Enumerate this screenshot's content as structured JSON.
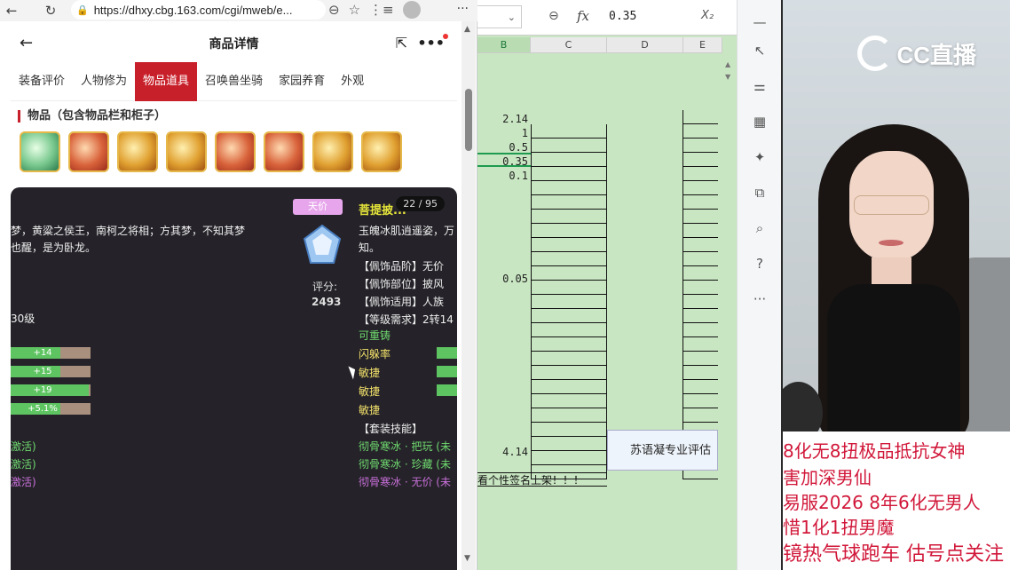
{
  "browser": {
    "url": "https://dhxy.cbg.163.com/cgi/mweb/e...",
    "page_title": "商品详情",
    "tabs": [
      "装备评价",
      "人物修为",
      "物品道具",
      "召唤兽坐骑",
      "家园养育",
      "外观"
    ],
    "active_tab": "物品道具",
    "section_title": "物品（包含物品栏和柜子）",
    "detail": {
      "counter": "22 / 95",
      "badge": "天价",
      "item_name": "菩提披...",
      "story_left": [
        "梦，黄粱之侯王，南柯之将相；方其梦，不知其梦",
        "也醒，是为卧龙。"
      ],
      "story_right": [
        "玉魄冰肌逍遥姿，万",
        "知。"
      ],
      "score_label": "评分:",
      "score_value": "2493",
      "attrs": [
        "【佩饰品阶】无价",
        "【佩饰部位】披风",
        "【佩饰适用】人族",
        "【等级需求】2转14"
      ],
      "level_left": "30级",
      "rework": "可重铸",
      "bars": [
        {
          "label": "+14",
          "fill": 0.62
        },
        {
          "label": "+15",
          "fill": 0.62
        },
        {
          "label": "+19",
          "fill": 0.98
        },
        {
          "label": "+5.1%",
          "fill": 0.62
        }
      ],
      "stats_right": [
        "闪躲率",
        "敏捷",
        "敏捷",
        "敏捷"
      ],
      "set_skill_title": "【套装技能】",
      "set_skills": [
        {
          "text": "彻骨寒冰 · 把玩 (未",
          "color": "#6fd96f"
        },
        {
          "text": "彻骨寒冰 · 珍藏 (未",
          "color": "#6fd96f"
        },
        {
          "text": "彻骨寒冰 · 无价 (未",
          "color": "#c86fd9"
        }
      ],
      "activated": [
        {
          "text": "激活)",
          "color": "#6fd96f"
        },
        {
          "text": "激活)",
          "color": "#6fd96f"
        },
        {
          "text": "激活)",
          "color": "#c86fd9"
        }
      ]
    }
  },
  "sheet": {
    "formula_value": "0.35",
    "columns": [
      "B",
      "C",
      "D",
      "E"
    ],
    "values_b": [
      "2.14",
      "1",
      "0.5",
      "0.35",
      "0.1",
      "0.05",
      "4.14"
    ],
    "eval_text": "苏语凝专业评估",
    "bottom_text": "看个性签名上架！！！"
  },
  "stream": {
    "logo": "CC直播",
    "messages": [
      "8化无8扭极品抵抗女神",
      "害加深男仙",
      "易服2026 8年6化无男人",
      "惜1化1扭男魔",
      "镜热气球跑车   估号点关注"
    ]
  }
}
